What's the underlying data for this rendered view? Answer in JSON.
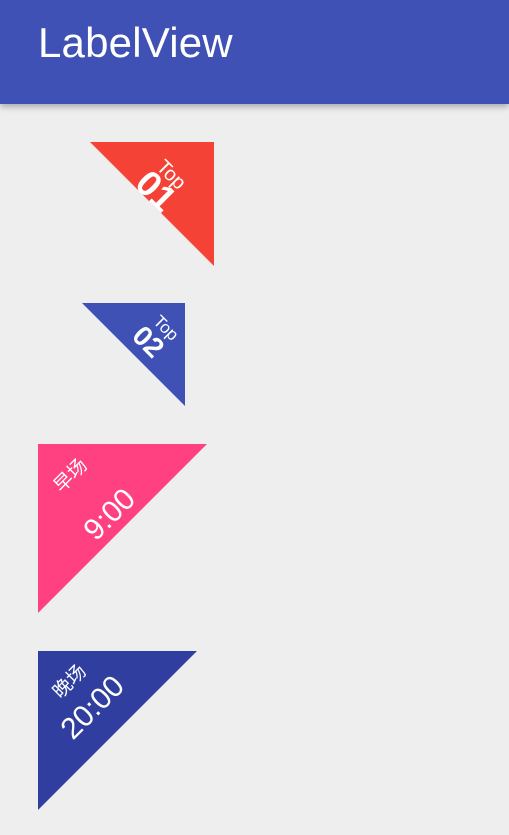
{
  "app_bar": {
    "title": "LabelView",
    "color": "#3f51b5"
  },
  "labels": [
    {
      "small": "Top",
      "big": "01",
      "color": "#f44336"
    },
    {
      "small": "Top",
      "big": "02",
      "color": "#3f51b5"
    },
    {
      "small": "早场",
      "big": "9:00",
      "color": "#ff4081"
    },
    {
      "small": "晚场",
      "big": "20:00",
      "color": "#303f9f"
    }
  ]
}
